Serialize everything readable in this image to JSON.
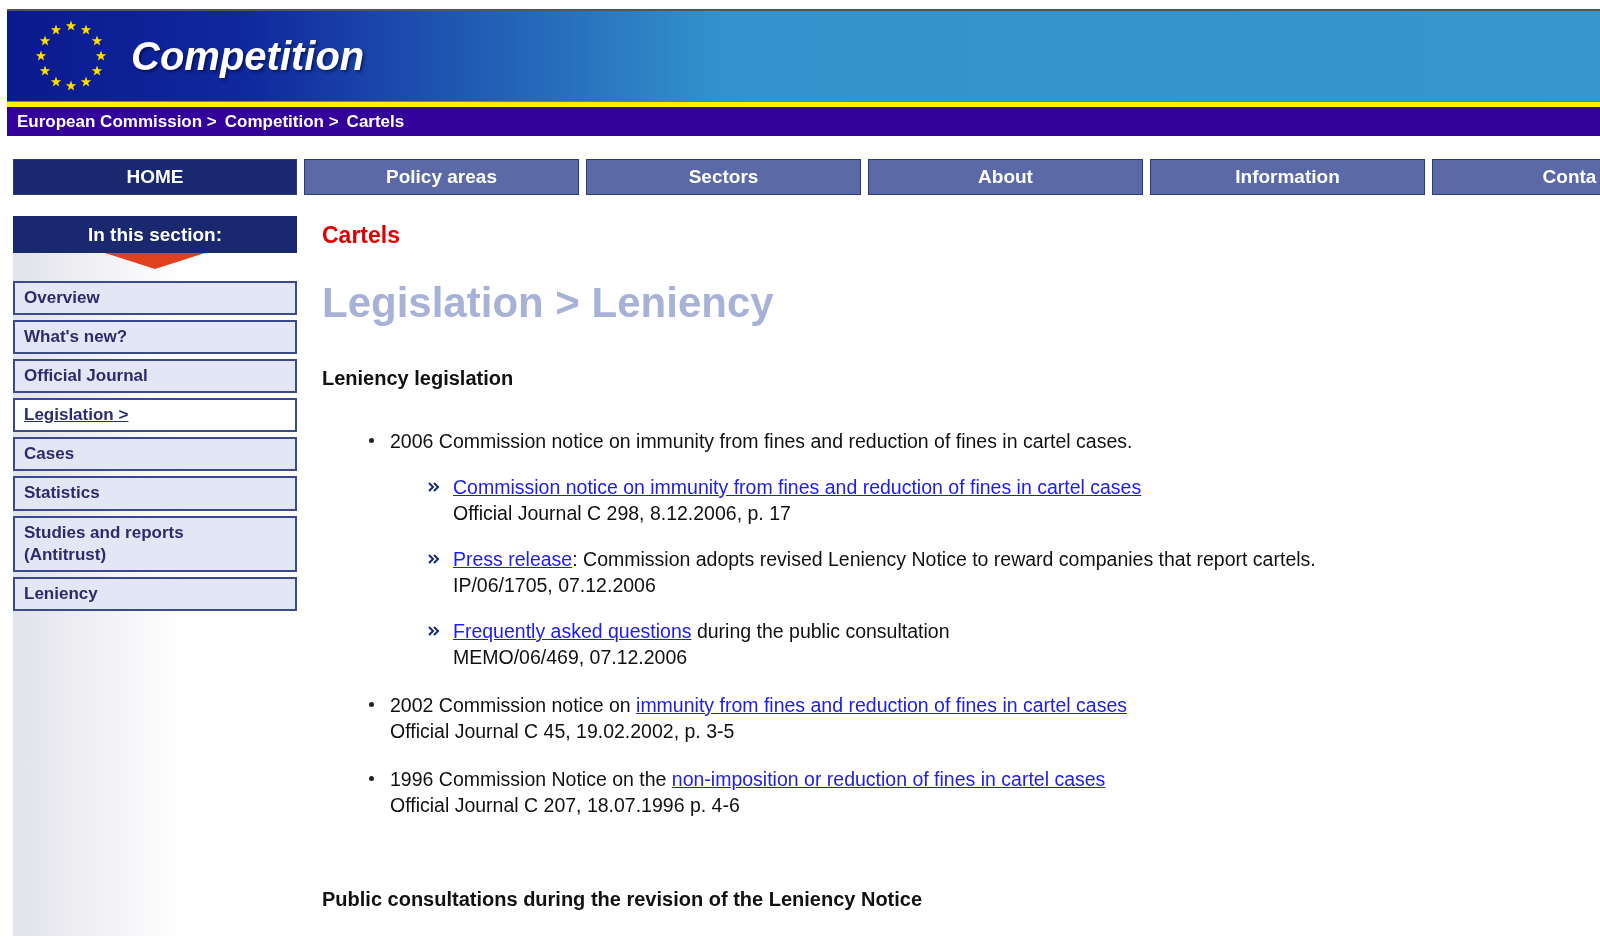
{
  "header": {
    "title": "Competition"
  },
  "breadcrumb": [
    "European Commission >",
    "Competition >",
    "Cartels"
  ],
  "nav": [
    {
      "label": "HOME",
      "selected": true
    },
    {
      "label": "Policy areas",
      "selected": false
    },
    {
      "label": "Sectors",
      "selected": false
    },
    {
      "label": "About",
      "selected": false
    },
    {
      "label": "Information",
      "selected": false
    },
    {
      "label": "Conta",
      "selected": false
    }
  ],
  "sidebar": {
    "heading": "In this section:",
    "items": [
      {
        "label": "Overview",
        "selected": false
      },
      {
        "label": "What's new?",
        "selected": false
      },
      {
        "label": "Official Journal",
        "selected": false
      },
      {
        "label": "Legislation >",
        "selected": true
      },
      {
        "label": "Cases",
        "selected": false
      },
      {
        "label": "Statistics",
        "selected": false
      },
      {
        "label": "Studies and reports (Antitrust)",
        "selected": false
      },
      {
        "label": "Leniency",
        "selected": false
      }
    ]
  },
  "content": {
    "section": "Cartels",
    "title": "Legislation > Leniency",
    "subheading": "Leniency legislation",
    "items": [
      {
        "segments": [
          {
            "text": "2006 Commission notice on immunity from fines and reduction of fines in cartel cases.",
            "link": false
          }
        ],
        "children": [
          {
            "segments": [
              {
                "text": "Commission notice on immunity from fines and reduction of fines in cartel cases",
                "link": true
              }
            ],
            "note": "Official Journal C 298, 8.12.2006, p. 17"
          },
          {
            "segments": [
              {
                "text": "Press release",
                "link": true
              },
              {
                "text": ": Commission adopts revised Leniency Notice to reward companies that report cartels.",
                "link": false
              }
            ],
            "note": "IP/06/1705, 07.12.2006"
          },
          {
            "segments": [
              {
                "text": "Frequently asked questions",
                "link": true
              },
              {
                "text": " during the public consultation",
                "link": false
              }
            ],
            "note": "MEMO/06/469, 07.12.2006"
          }
        ]
      },
      {
        "segments": [
          {
            "text": "2002 Commission notice on ",
            "link": false
          },
          {
            "text": "immunity from fines and reduction of fines in cartel cases",
            "link": true
          }
        ],
        "note": "Official Journal C 45, 19.02.2002, p. 3-5"
      },
      {
        "segments": [
          {
            "text": "1996 Commission Notice on the ",
            "link": false
          },
          {
            "text": "non-imposition or reduction of fines in cartel cases",
            "link": true
          }
        ],
        "note": "Official Journal C 207, 18.07.1996 p. 4-6"
      }
    ],
    "footer_heading": "Public consultations during the revision of the Leniency Notice"
  }
}
